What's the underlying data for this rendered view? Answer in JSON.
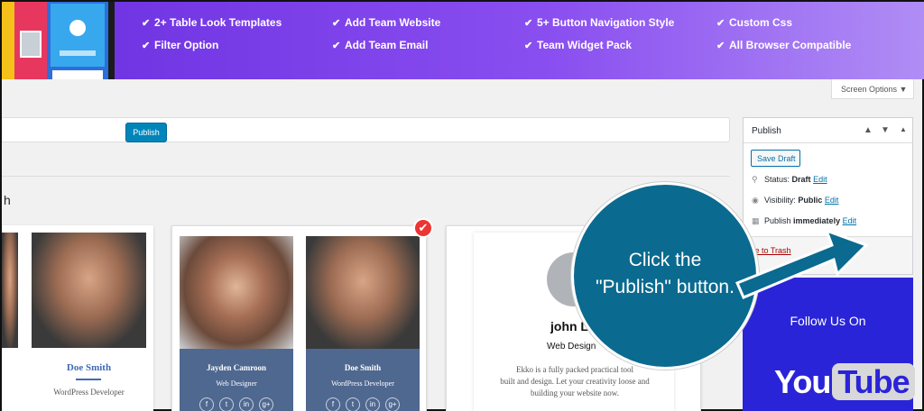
{
  "banner": {
    "features": [
      {
        "label": "2+ Table Look Templates"
      },
      {
        "label": "Add Team Website"
      },
      {
        "label": "5+ Button Navigation Style"
      },
      {
        "label": "Custom Css"
      },
      {
        "label": "Filter Option"
      },
      {
        "label": "Add Team Email"
      },
      {
        "label": "Team Widget Pack"
      },
      {
        "label": "All Browser Compatible"
      }
    ]
  },
  "screen_options": "Screen Options ▼",
  "templates": {
    "left": {
      "name": "Doe Smith",
      "role": "WordPress Developer"
    },
    "mid": [
      {
        "name": "Jayden Camroon",
        "role": "Web Designer"
      },
      {
        "name": "Doe Smith",
        "role": "WordPress Developer"
      }
    ],
    "right": {
      "name": "john L",
      "role": "Web Design",
      "bio": [
        "Ekko is a fully packed practical tool",
        "built and design. Let your creativity loose and",
        "building your website now."
      ]
    }
  },
  "publish_box": {
    "title": "Publish",
    "save_draft": "Save Draft",
    "status_label": "Status:",
    "status_value": "Draft",
    "visibility_label": "Visibility:",
    "visibility_value": "Public",
    "publish_label": "Publish",
    "publish_value": "immediately",
    "edit": "Edit",
    "trash": "ove to Trash",
    "publish_button": "Publish"
  },
  "widget": {
    "title": "Follow Us On",
    "you": "You",
    "tube": "Tube"
  },
  "callout": {
    "line1": "Click the",
    "line2": "\"Publish\" button."
  },
  "colors": {
    "accent": "#0085ba",
    "banner_start": "#6a2ee0",
    "callout": "#0b6a8f",
    "widget": "#2a24d8"
  }
}
